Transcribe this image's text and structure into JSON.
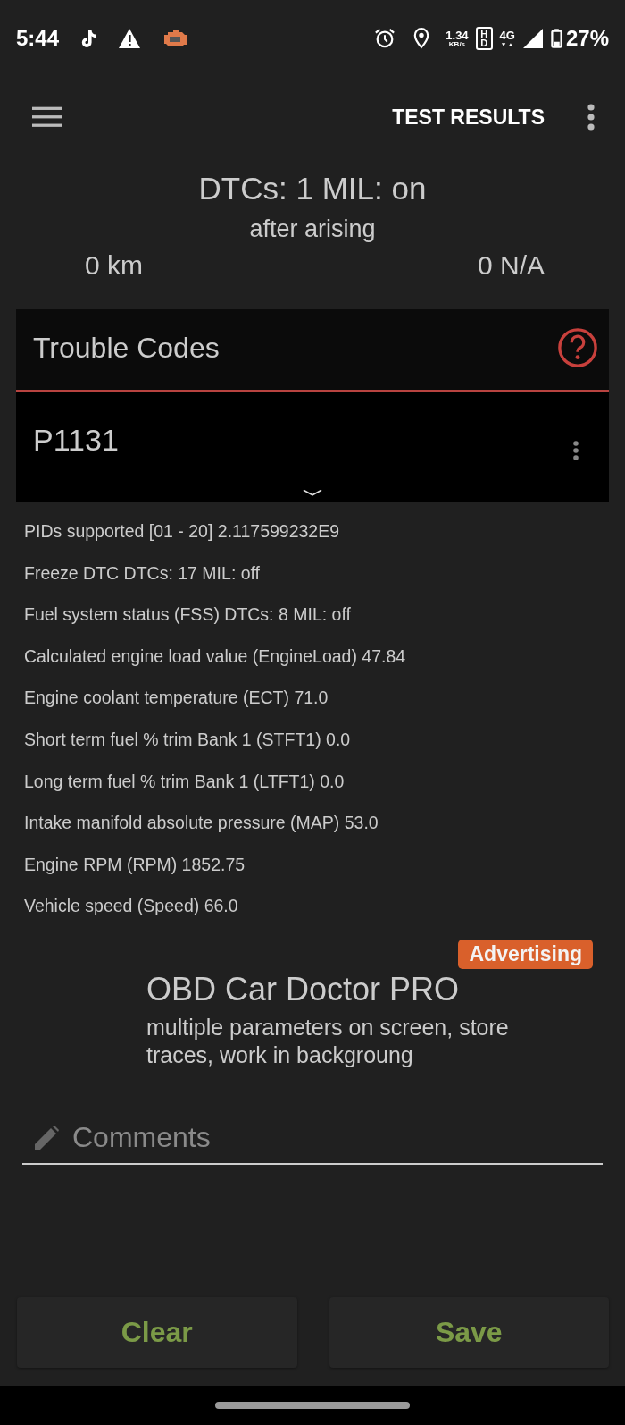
{
  "status_bar": {
    "time": "5:44",
    "net_speed": "1.34",
    "net_unit": "KB/s",
    "hd": "HD",
    "network": "4G",
    "battery": "27%"
  },
  "toolbar": {
    "title": "TEST RESULTS"
  },
  "summary": {
    "headline": "DTCs: 1 MIL: on",
    "subtitle": "after arising",
    "distance": "0 km",
    "value_2": "0 N/A"
  },
  "trouble_codes": {
    "title": "Trouble Codes",
    "codes": [
      "P1131"
    ]
  },
  "parameters": [
    "PIDs supported [01 - 20] 2.117599232E9",
    "Freeze DTC DTCs: 17 MIL: off",
    "Fuel system status (FSS) DTCs: 8 MIL: off",
    "Calculated engine load value (EngineLoad) 47.84",
    "Engine coolant temperature (ECT) 71.0",
    "Short term fuel % trim Bank 1 (STFT1) 0.0",
    "Long term fuel % trim Bank 1 (LTFT1) 0.0",
    "Intake manifold absolute pressure (MAP) 53.0",
    "Engine RPM (RPM) 1852.75",
    "Vehicle speed (Speed) 66.0"
  ],
  "ad": {
    "badge": "Advertising",
    "title": "OBD Car Doctor PRO",
    "description": "multiple parameters on screen, store traces, work in backgroung"
  },
  "comments": {
    "placeholder": "Comments"
  },
  "buttons": [
    "Clear",
    "Save"
  ]
}
